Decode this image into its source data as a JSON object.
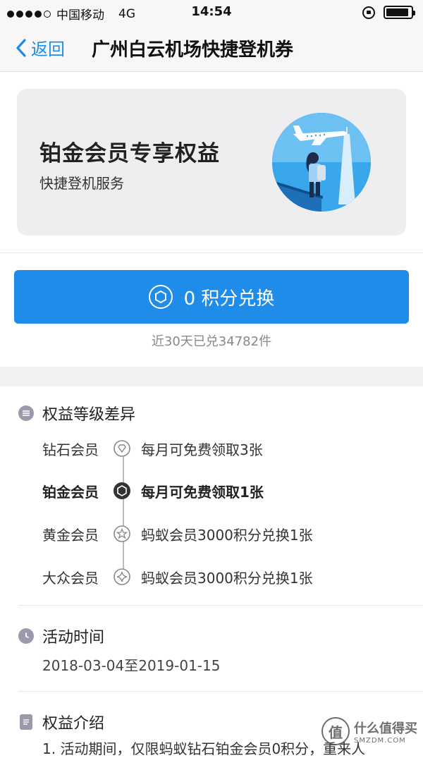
{
  "status_bar": {
    "carrier": "中国移动",
    "network": "4G",
    "time": "14:54",
    "battery_level": 0.92
  },
  "nav": {
    "back_label": "返回",
    "title": "广州白云机场快捷登机券"
  },
  "hero": {
    "title": "铂金会员专享权益",
    "subtitle": "快捷登机服务",
    "image_icon": "airplane-traveler-illustration"
  },
  "redeem": {
    "label": "0 积分兑换",
    "count_text": "近30天已兑34782件"
  },
  "levels_section": {
    "title": "权益等级差异",
    "icon": "list-icon",
    "rows": [
      {
        "name": "钻石会员",
        "benefit": "每月可免费领取3张",
        "icon": "diamond-badge-icon",
        "active": false
      },
      {
        "name": "铂金会员",
        "benefit": "每月可免费领取1张",
        "icon": "platinum-badge-icon",
        "active": true
      },
      {
        "name": "黄金会员",
        "benefit": "蚂蚁会员3000积分兑换1张",
        "icon": "gold-star-badge-icon",
        "active": false
      },
      {
        "name": "大众会员",
        "benefit": "蚂蚁会员3000积分兑换1张",
        "icon": "public-badge-icon",
        "active": false
      }
    ]
  },
  "time_section": {
    "title": "活动时间",
    "icon": "clock-icon",
    "value": "2018-03-04至2019-01-15"
  },
  "intro_section": {
    "title": "权益介绍",
    "icon": "document-icon",
    "line1": "1. 活动期间，仅限蚂蚁钻石铂金会员0积分，重来人"
  },
  "watermark": {
    "logo_char": "值",
    "text": "什么值得买",
    "sub": "SMZDM.COM"
  },
  "colors": {
    "accent": "#1e8ce8",
    "icon_gray": "#9a9aac"
  }
}
